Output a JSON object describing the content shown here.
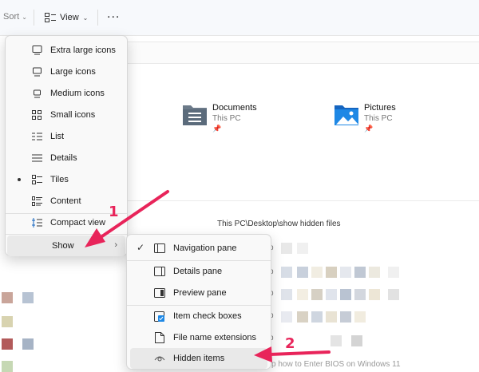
{
  "toolbar": {
    "sort_label": "Sort",
    "view_label": "View",
    "more_label": "..."
  },
  "folders": [
    {
      "name": "Documents",
      "location": "This PC"
    },
    {
      "name": "Pictures",
      "location": "This PC"
    }
  ],
  "path_caption": "This PC\\Desktop\\show hidden files",
  "bottom_text": "p how to Enter BIOS on Windows 11",
  "view_menu": {
    "items": [
      {
        "label": "Extra large icons",
        "icon": "monitor-icon"
      },
      {
        "label": "Large icons",
        "icon": "monitor-icon"
      },
      {
        "label": "Medium icons",
        "icon": "monitor-icon"
      },
      {
        "label": "Small icons",
        "icon": "small-icons-grid-icon"
      },
      {
        "label": "List",
        "icon": "list-icon"
      },
      {
        "label": "Details",
        "icon": "details-icon"
      },
      {
        "label": "Tiles",
        "icon": "tiles-icon",
        "selected": true
      },
      {
        "label": "Content",
        "icon": "content-icon"
      },
      {
        "label": "Compact view",
        "icon": "compact-view-icon"
      },
      {
        "label": "Show",
        "icon": "",
        "submenu": true,
        "highlighted": true
      }
    ]
  },
  "show_menu": {
    "items": [
      {
        "label": "Navigation pane",
        "icon": "navigation-pane-icon",
        "checked": true
      },
      {
        "label": "Details pane",
        "icon": "details-pane-icon"
      },
      {
        "label": "Preview pane",
        "icon": "preview-pane-icon"
      },
      {
        "label": "Item check boxes",
        "icon": "checkbox-icon"
      },
      {
        "label": "File name extensions",
        "icon": "file-icon"
      },
      {
        "label": "Hidden items",
        "icon": "eye-icon",
        "highlighted": true
      }
    ]
  },
  "annotations": [
    {
      "label": "1"
    },
    {
      "label": "2"
    }
  ],
  "colors": {
    "accent": "#e8245a",
    "folder_blue": "#1e88e5",
    "folder_gray": "#5b6b7b"
  }
}
